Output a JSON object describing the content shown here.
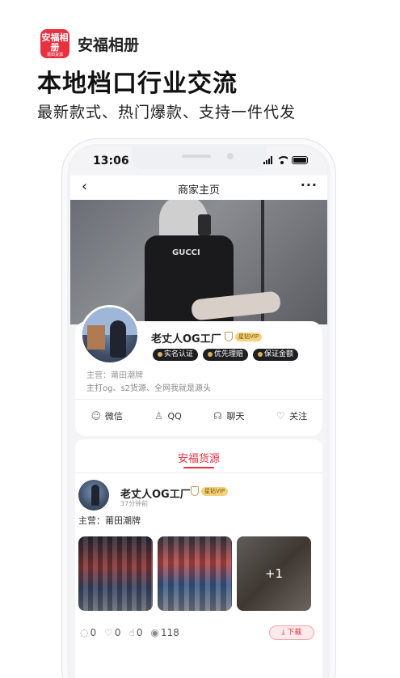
{
  "promo": {
    "logo_main": "安福相册",
    "logo_sub": "莆田货源",
    "app_name": "安福相册",
    "headline": "本地档口行业交流",
    "subline": "最新款式、热门爆款、支持一件代发"
  },
  "status_bar": {
    "time": "13:06"
  },
  "nav": {
    "back": "‹",
    "title": "商家主页",
    "more": "···"
  },
  "cover": {
    "shirt_text": "GUCCI"
  },
  "profile": {
    "shop_name": "老丈人OG工厂",
    "vip_label": "星钻VIP",
    "tags": [
      "实名认证",
      "优先理赔",
      "保证金额"
    ],
    "main_business": "主营：莆田潮牌",
    "description": "主打og、s2货源、全网我就是源头",
    "actions": [
      {
        "label": "微信",
        "icon": "wechat-icon"
      },
      {
        "label": "QQ",
        "icon": "qq-icon"
      },
      {
        "label": "聊天",
        "icon": "chat-icon"
      },
      {
        "label": "关注",
        "icon": "follow-icon"
      }
    ]
  },
  "section": {
    "title": "安福货源"
  },
  "post": {
    "name": "老丈人OG工厂",
    "vip_label": "星钻VIP",
    "time": "37分钟前",
    "text": "主营：莆田潮牌",
    "more_count": "+1",
    "stats": {
      "comments": "0",
      "likes": "0",
      "thumbs_up": "0",
      "views": "118"
    },
    "download_label": "下载"
  },
  "colors": {
    "accent": "#e8313e",
    "tag_bg": "#1f1f22",
    "vip_gold": "#f3d27a"
  }
}
